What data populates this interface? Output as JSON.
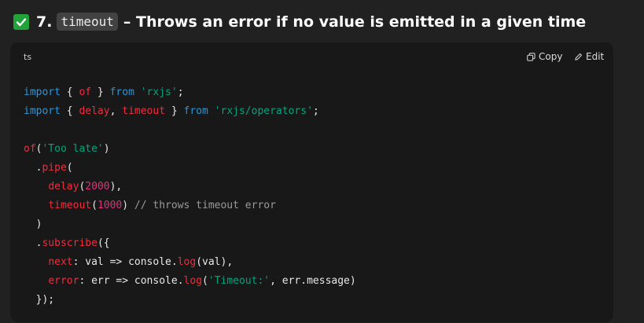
{
  "heading": {
    "number": "7.",
    "code": "timeout",
    "text": "– Throws an error if no value is emitted in a given time"
  },
  "code_block": {
    "language": "ts",
    "copy_label": "Copy",
    "edit_label": "Edit",
    "lines": [
      "import { of } from 'rxjs';",
      "import { delay, timeout } from 'rxjs/operators';",
      "",
      "of('Too late')",
      "  .pipe(",
      "    delay(2000),",
      "    timeout(1000) // throws timeout error",
      "  )",
      "  .subscribe({",
      "    next: val => console.log(val),",
      "    error: err => console.log('Timeout:', err.message)",
      "  });"
    ]
  },
  "colors": {
    "background": "#212121",
    "code_background": "#181818",
    "keyword": "#2e95d3",
    "string": "#00a67d",
    "function": "#f22c3d",
    "number": "#df3079",
    "comment": "#9a9a9a",
    "check": "#22a33a"
  },
  "icons": [
    "check-mark-icon",
    "copy-icon",
    "edit-icon"
  ]
}
